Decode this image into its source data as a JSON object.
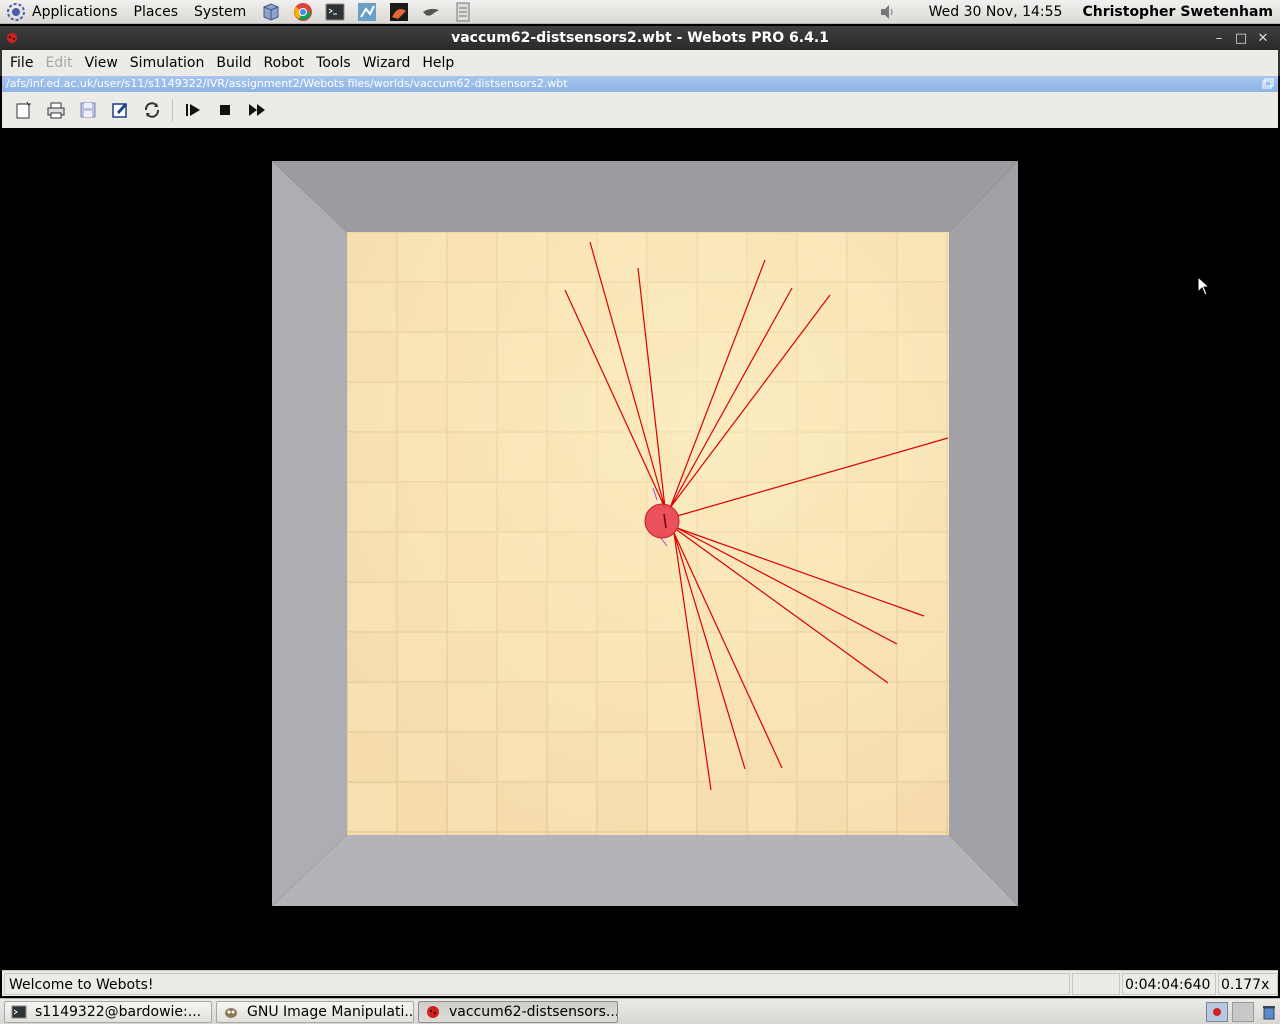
{
  "top_panel": {
    "menus": [
      "Applications",
      "Places",
      "System"
    ],
    "launchers": [
      "package-icon",
      "chrome-icon",
      "terminal-icon",
      "network-icon",
      "matlab-icon",
      "bird-icon",
      "document-icon"
    ],
    "clock": "Wed 30 Nov, 14:55",
    "username": "Christopher Swetenham"
  },
  "window": {
    "title": "vaccum62-distsensors2.wbt - Webots PRO 6.4.1",
    "controls": {
      "minimize": "–",
      "maximize": "□",
      "close": "✕"
    }
  },
  "menubar": {
    "items": [
      {
        "label": "File",
        "enabled": true
      },
      {
        "label": "Edit",
        "enabled": false
      },
      {
        "label": "View",
        "enabled": true
      },
      {
        "label": "Simulation",
        "enabled": true
      },
      {
        "label": "Build",
        "enabled": true
      },
      {
        "label": "Robot",
        "enabled": true
      },
      {
        "label": "Tools",
        "enabled": true
      },
      {
        "label": "Wizard",
        "enabled": true
      },
      {
        "label": "Help",
        "enabled": true
      }
    ]
  },
  "pathbar": {
    "path": "/afs/inf.ed.ac.uk/user/s11/s1149322/IVR/assignment2/Webots files/worlds/vaccum62-distsensors2.wbt"
  },
  "toolbar": {
    "buttons": [
      "new-world-icon",
      "print-icon",
      "save-icon",
      "edit-icon",
      "revert-icon",
      "step-icon",
      "stop-icon",
      "fast-forward-icon"
    ]
  },
  "status": {
    "message": "Welcome to Webots!",
    "time": "0:04:04:640",
    "speed": "0.177x"
  },
  "taskbar": {
    "tasks": [
      {
        "label": "s1149322@bardowie:...",
        "icon": "terminal-icon",
        "active": false
      },
      {
        "label": "GNU Image Manipulati...",
        "icon": "gimp-icon",
        "active": false
      },
      {
        "label": "vaccum62-distsensors...",
        "icon": "webots-icon",
        "active": true
      }
    ]
  },
  "colors": {
    "sensor_ray": "#dd0000",
    "robot": "#e8404c",
    "floor": "#f6dcaa",
    "wall": "#a7a7a9",
    "titlebar": "#333333",
    "pathbar": "#9bbdea"
  }
}
